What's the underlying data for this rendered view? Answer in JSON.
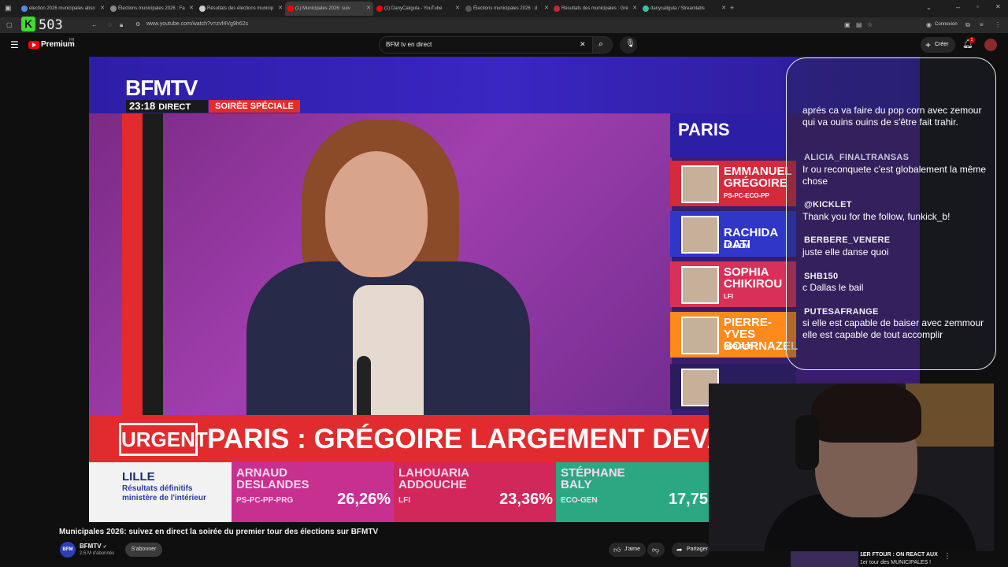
{
  "browser": {
    "tabs": [
      {
        "label": "election 2026 municipales abso",
        "fav": "#4a90e2"
      },
      {
        "label": "Élections municipales 2026 : Fa",
        "fav": "#888888"
      },
      {
        "label": "Résultats des élections municip",
        "fav": "#cccccc"
      },
      {
        "label": "(1) Municipales 2026: suiv",
        "fav": "#ff0000"
      },
      {
        "label": "(1) DanyCaligula - YouTube",
        "fav": "#ff0000"
      },
      {
        "label": "Élections municipales 2026 : d",
        "fav": "#555555"
      },
      {
        "label": "Résultats des municipales : Gré",
        "fav": "#cc2233"
      },
      {
        "label": "danycaligula / Streamlabs",
        "fav": "#31c3a2"
      }
    ],
    "url": "www.youtube.com/watch?v=zvf4Vg9h62s",
    "overlay_counter": "503",
    "profile_label": "Connexion"
  },
  "youtube": {
    "logo_label": "Premium",
    "region": "FR",
    "search_value": "BFM tv en direct",
    "create_label": "Créer",
    "notif_count": "1"
  },
  "video": {
    "channel_logo": "BFMTV",
    "time": "23:18",
    "direct_label": "DIRECT",
    "soiree_label": "SOIRÉE SPÉCIALE",
    "results_city": "PARIS",
    "candidates": [
      {
        "name": "EMMANUEL\nGRÉGOIRE",
        "party": "PS-PC-ECO-PP",
        "color": "#d42a3c"
      },
      {
        "name": "RACHIDA DATI",
        "party": "LR-MDM",
        "color": "#2f36c8"
      },
      {
        "name": "SOPHIA\nCHIKIROU",
        "party": "LFI",
        "color": "#d9305a"
      },
      {
        "name": "PIERRE-YVES\nBOURNAZEL",
        "party": "HOR-REN",
        "color": "#ff8a1c"
      },
      {
        "name": "",
        "party": "",
        "color": "#2a1d5e"
      }
    ],
    "urgent_label": "URGENT",
    "headline": "PARIS : GRÉGOIRE LARGEMENT DEVANT DATI",
    "results_strip": {
      "city": "LILLE",
      "subtitle": "Résultats définitifs\nministère de l'intérieur",
      "cells": [
        {
          "name": "ARNAUD\nDESLANDES",
          "party": "PS-PC-PP-PRG",
          "pct": "26,26%",
          "color": "#c8308f"
        },
        {
          "name": "LAHOUARIA\nADDOUCHE",
          "party": "LFI",
          "pct": "23,36%",
          "color": "#d2275a"
        },
        {
          "name": "STÉPHANE\nBALY",
          "party": "ECO-GEN",
          "pct": "17,75",
          "color": "#2ba882"
        }
      ]
    }
  },
  "chat": {
    "messages": [
      {
        "user": "",
        "text": "aprés ca va faire du pop corn avec zemour qui va ouins ouins de s'être fait trahir."
      },
      {
        "user": "ALICIA_FINALTRANSAS",
        "text": "Ir ou reconquete c'est globalement la même chose"
      },
      {
        "user": "@KICKLET",
        "text": "Thank you for the follow, funkick_b!"
      },
      {
        "user": "BERBERE_VENERE",
        "text": "juste elle danse quoi"
      },
      {
        "user": "SHB150",
        "text": "c Dallas le bail"
      },
      {
        "user": "PUTESAFRANGE",
        "text": "si elle est capable de baiser avec zemmour elle est capable de tout accomplir"
      }
    ]
  },
  "meta": {
    "title": "Municipales 2026: suivez en direct la soirée du premier tour des élections sur BFMTV",
    "channel_logo": "BFM",
    "channel": "BFMTV",
    "subscribers": "2,6 M d'abonnés",
    "subscribe_label": "S'abonner",
    "like_label": "J'aime",
    "share_label": "Partager",
    "recommended_line1": "1ER FTOUR : ON REACT AUX",
    "recommended_line2": "1er tour des MUNICIPALES !"
  }
}
